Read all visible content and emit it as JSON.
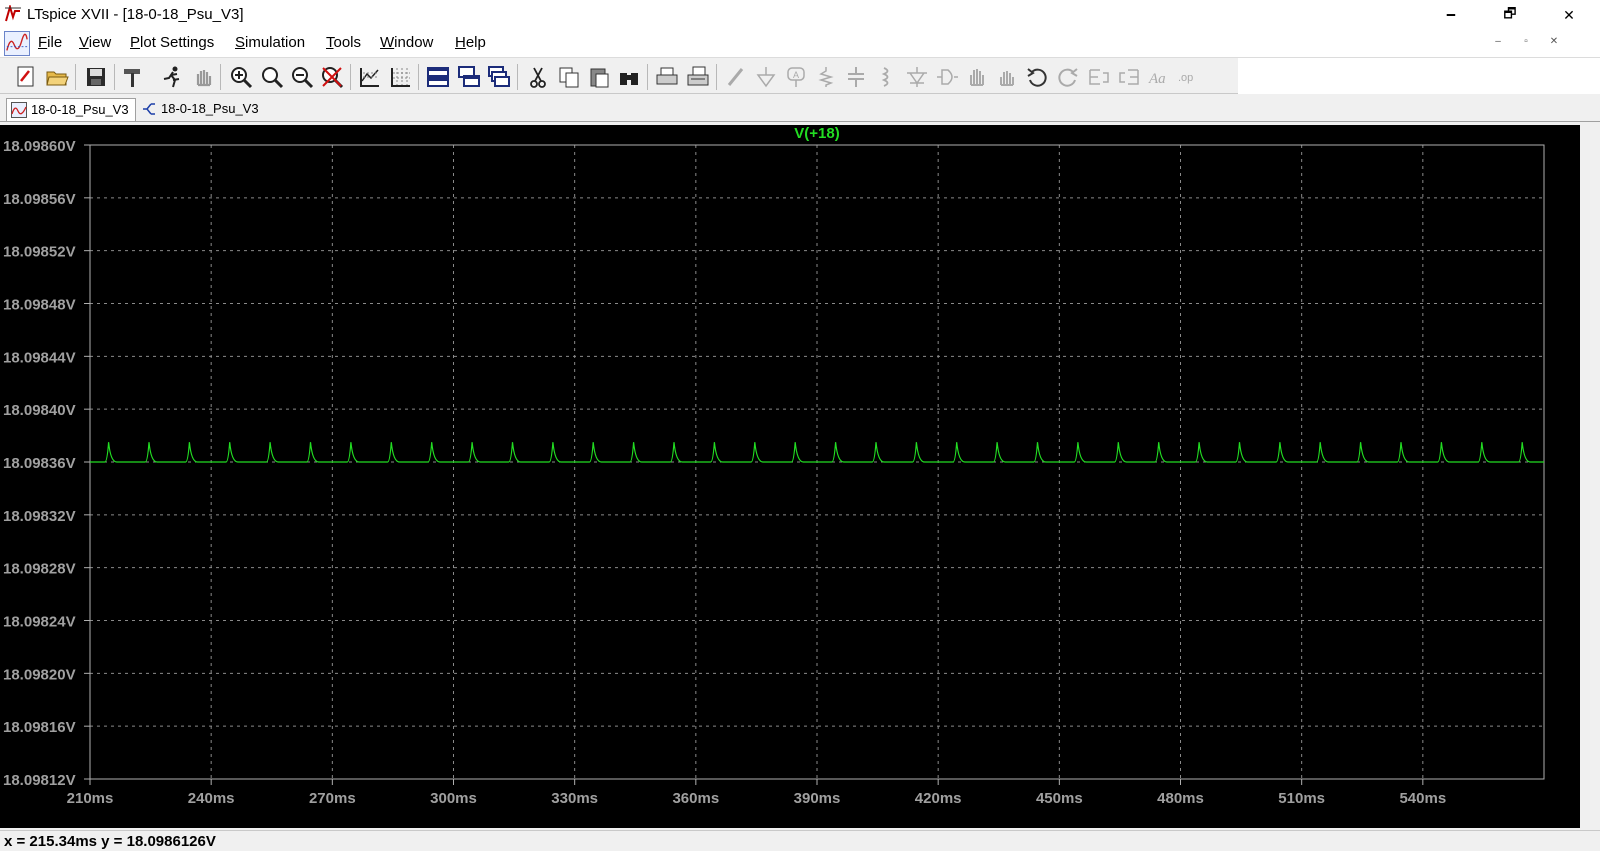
{
  "window": {
    "title": "LTspice XVII - [18-0-18_Psu_V3]",
    "minimize": "🗕",
    "maximize": "🗗",
    "close": "✕"
  },
  "menu": {
    "items": [
      "File",
      "View",
      "Plot Settings",
      "Simulation",
      "Tools",
      "Window",
      "Help"
    ],
    "mdi_controls": [
      "–",
      "▫",
      "✕"
    ]
  },
  "toolbar": {
    "buttons": [
      "open-schematic-icon",
      "open-folder-icon",
      "save-icon",
      "hammer-icon",
      "run-icon",
      "pan-hand-icon",
      "zoom-in-icon",
      "zoom-area-icon",
      "zoom-out-icon",
      "zoom-cancel-icon",
      "autorange-icon",
      "grid-icon",
      "tile-horizontal-icon",
      "tile-vertical-icon",
      "cascade-icon",
      "cut-icon",
      "copy-icon",
      "paste-icon",
      "find-icon",
      "print-icon",
      "print-preview-icon",
      "wire-icon",
      "ground-icon",
      "label-icon",
      "resistor-icon",
      "capacitor-icon",
      "inductor-icon",
      "diode-icon",
      "component-icon",
      "move-icon",
      "drag-icon",
      "undo-icon",
      "redo-icon",
      "rotate-icon",
      "mirror-icon",
      "text-icon",
      "spice-directive-icon"
    ]
  },
  "tabs": [
    {
      "label": "18-0-18_Psu_V3",
      "icon": "waveform-icon",
      "active": true
    },
    {
      "label": "18-0-18_Psu_V3",
      "icon": "schematic-icon",
      "active": false
    }
  ],
  "colors": {
    "plot_background": "#000000",
    "trace": "#22dd22",
    "grid": "#8a8a8a",
    "axis_text": "#a0a0a0"
  },
  "chart_data": {
    "type": "line",
    "title": "V(+18)",
    "xlabel": "",
    "ylabel": "",
    "x_unit": "ms",
    "y_unit": "V",
    "xlim": [
      210,
      570
    ],
    "ylim": [
      18.09812,
      18.0986
    ],
    "x_ticks": [
      "210ms",
      "240ms",
      "270ms",
      "300ms",
      "330ms",
      "360ms",
      "390ms",
      "420ms",
      "450ms",
      "480ms",
      "510ms",
      "540ms"
    ],
    "y_ticks": [
      "18.09860V",
      "18.09856V",
      "18.09852V",
      "18.09848V",
      "18.09844V",
      "18.09840V",
      "18.09836V",
      "18.09832V",
      "18.09828V",
      "18.09824V",
      "18.09820V",
      "18.09816V",
      "18.09812V"
    ],
    "grid": true,
    "series": [
      {
        "name": "V(+18)",
        "baseline": 18.09836,
        "peak": 18.098375,
        "pulse_period_ms": 10,
        "first_pulse_ms": 214.6,
        "last_pulse_ms": 564.6
      }
    ]
  },
  "status": {
    "text": "x = 215.34ms    y = 18.0986126V"
  }
}
